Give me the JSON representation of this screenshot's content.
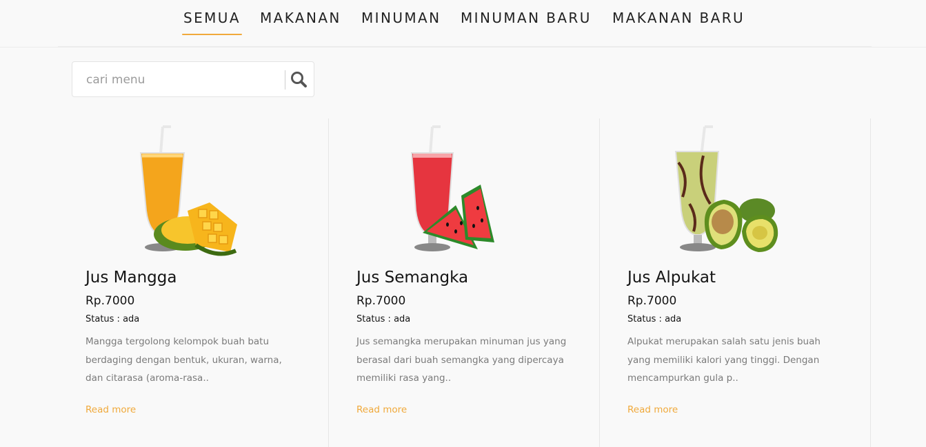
{
  "tabs": [
    {
      "label": "SEMUA",
      "active": true
    },
    {
      "label": "MAKANAN",
      "active": false
    },
    {
      "label": "MINUMAN",
      "active": false
    },
    {
      "label": "MINUMAN BARU",
      "active": false
    },
    {
      "label": "MAKANAN BARU",
      "active": false
    }
  ],
  "search": {
    "placeholder": "cari menu",
    "value": "",
    "icon": "search-icon"
  },
  "colors": {
    "accent": "#f0a93b",
    "background": "#f9f9f9"
  },
  "cards": [
    {
      "title": "Jus Mangga",
      "price": "Rp.7000",
      "status": "Status : ada",
      "description": "Mangga tergolong kelompok buah batu berdaging dengan bentuk, ukuran, warna, dan citarasa (aroma-rasa..",
      "read_more": "Read more",
      "image": "mango-juice-image"
    },
    {
      "title": "Jus Semangka",
      "price": "Rp.7000",
      "status": "Status : ada",
      "description": "Jus semangka merupakan minuman jus yang berasal dari buah semangka yang dipercaya memiliki rasa yang..",
      "read_more": "Read more",
      "image": "watermelon-juice-image"
    },
    {
      "title": "Jus Alpukat",
      "price": "Rp.7000",
      "status": "Status : ada",
      "description": "Alpukat merupakan salah satu jenis buah yang memiliki kalori yang tinggi. Dengan mencampurkan gula p..",
      "read_more": "Read more",
      "image": "avocado-juice-image"
    }
  ]
}
